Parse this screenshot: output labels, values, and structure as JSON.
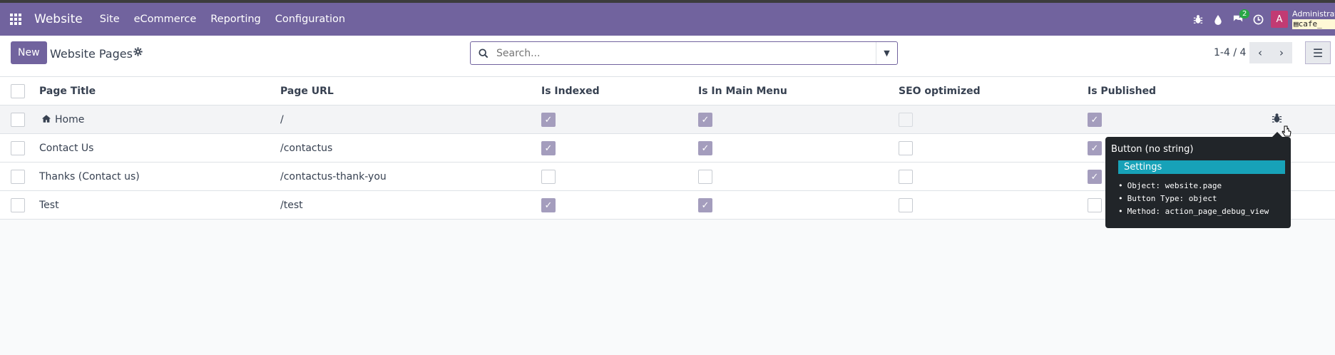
{
  "navbar": {
    "brand": "Website",
    "menu": [
      "Site",
      "eCommerce",
      "Reporting",
      "Configuration"
    ],
    "chat_badge": "2",
    "avatar_letter": "A",
    "user_name": "Administrator",
    "db_name": "cafe_"
  },
  "control_panel": {
    "new_label": "New",
    "title": "Website Pages",
    "search_placeholder": "Search...",
    "pager": "1-4 / 4"
  },
  "table": {
    "headers": [
      "Page Title",
      "Page URL",
      "Is Indexed",
      "Is In Main Menu",
      "SEO optimized",
      "Is Published"
    ],
    "rows": [
      {
        "title": "Home",
        "url": "/",
        "indexed": true,
        "main_menu": true,
        "seo": false,
        "published": true,
        "home_icon": "home-icon"
      },
      {
        "title": "Contact Us",
        "url": "/contactus",
        "indexed": true,
        "main_menu": true,
        "seo": false,
        "published": true
      },
      {
        "title": "Thanks (Contact us)",
        "url": "/contactus-thank-you",
        "indexed": false,
        "main_menu": false,
        "seo": false,
        "published": true
      },
      {
        "title": "Test",
        "url": "/test",
        "indexed": true,
        "main_menu": true,
        "seo": false,
        "published": false
      }
    ]
  },
  "tooltip": {
    "title": "Button (no string)",
    "help": "Settings",
    "items": [
      {
        "key": "Object:",
        "value": "website.page"
      },
      {
        "key": "Button Type:",
        "value": "object"
      },
      {
        "key": "Method:",
        "value": "action_page_debug_view"
      }
    ]
  },
  "colors": {
    "navbar": "#71639e",
    "primary": "#71639e",
    "checkbox_checked": "#a49dbd",
    "tooltip_bg": "#212529",
    "tooltip_help_bg": "#17a2b8",
    "avatar": "#c23b73"
  }
}
